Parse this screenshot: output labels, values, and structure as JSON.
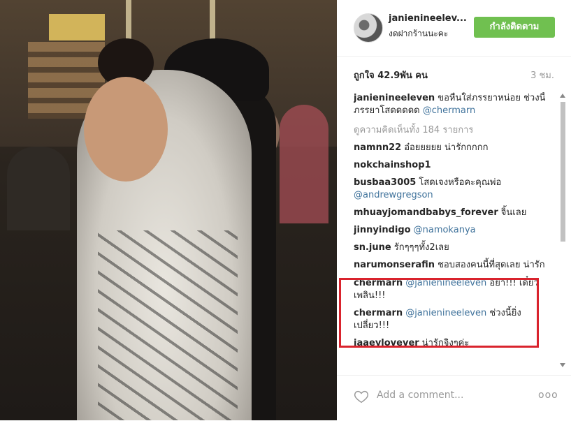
{
  "post": {
    "username": "janienineelev...",
    "location": "งดฝากร้านนะคะ",
    "follow_label": "กำลังติดตาม",
    "likes": "ถูกใจ 42.9พัน คน",
    "time": "3 ชม."
  },
  "caption": {
    "user": "janienineeleven",
    "text": "ขอหื่นใส่ภรรยาหน่อย ช่วงนี้ภรรยาโสดดดดด",
    "mention": "@chermarn"
  },
  "view_all": "ดูความคิดเห็นทั้ง 184 รายการ",
  "comments": [
    {
      "user": "namnn22",
      "text": "อ๋อยยยยย น่ารักกกกก",
      "mention": ""
    },
    {
      "user": "nokchainshop1",
      "text": "",
      "mention": ""
    },
    {
      "user": "busbaa3005",
      "text": "โสดเจงหรือคะคุณพ่อ",
      "mention": "@andrewgregson"
    },
    {
      "user": "mhuayjomandbabys_forever",
      "text": "จิ้นเลย",
      "mention": ""
    },
    {
      "user": "jinnyindigo",
      "text": "",
      "mention": "@namokanya"
    },
    {
      "user": "sn.june",
      "text": "รักๆๆๆทั้ง2เลย",
      "mention": ""
    },
    {
      "user": "narumonserafin",
      "text": "ชอบสองคนนี้ที่สุดเลย น่ารัก",
      "mention": ""
    }
  ],
  "highlighted": [
    {
      "user": "chermarn",
      "mention": "@janienineeleven",
      "text": "อย่า!!! เดี๋ยวเพลิน!!!"
    },
    {
      "user": "chermarn",
      "mention": "@janienineeleven",
      "text": "ช่วงนี้ยิ่งเปลี่ยว!!!"
    }
  ],
  "after": [
    {
      "user": "jaaeylovever",
      "text": "น่ารักจิงๆค่ะ",
      "mention": ""
    }
  ],
  "footer": {
    "add_comment": "Add a comment...",
    "more": "ooo",
    "heart_icon": "heart-icon"
  },
  "colors": {
    "follow_green": "#70c050",
    "mention_blue": "#3f729b",
    "highlight_red": "#d9232d"
  }
}
